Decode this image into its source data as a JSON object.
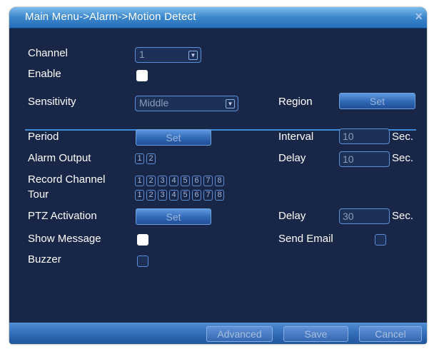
{
  "window": {
    "title": "Main Menu->Alarm->Motion Detect",
    "close_glyph": "×"
  },
  "fields": {
    "channel": {
      "label": "Channel",
      "value": "1"
    },
    "enable": {
      "label": "Enable",
      "checked": true
    },
    "sensitivity": {
      "label": "Sensitivity",
      "value": "Middle"
    },
    "region": {
      "label": "Region",
      "button": "Set"
    },
    "period": {
      "label": "Period",
      "button": "Set"
    },
    "interval": {
      "label": "Interval",
      "value": "10",
      "unit": "Sec."
    },
    "alarm_output": {
      "label": "Alarm Output",
      "options": [
        "1",
        "2"
      ]
    },
    "delay1": {
      "label": "Delay",
      "value": "10",
      "unit": "Sec."
    },
    "record_channel": {
      "label": "Record Channel",
      "options": [
        "1",
        "2",
        "3",
        "4",
        "5",
        "6",
        "7",
        "8"
      ]
    },
    "tour": {
      "label": "Tour",
      "options": [
        "1",
        "2",
        "3",
        "4",
        "5",
        "6",
        "7",
        "8"
      ]
    },
    "ptz": {
      "label": "PTZ Activation",
      "button": "Set"
    },
    "delay2": {
      "label": "Delay",
      "value": "30",
      "unit": "Sec."
    },
    "show_message": {
      "label": "Show Message",
      "checked": true
    },
    "send_email": {
      "label": "Send Email",
      "checked": false
    },
    "buzzer": {
      "label": "Buzzer",
      "checked": false
    }
  },
  "footer": {
    "advanced": "Advanced",
    "save": "Save",
    "cancel": "Cancel"
  },
  "colors": {
    "titlebar": "#3b86cb",
    "panel": "#182747",
    "border": "#5b8fd6"
  }
}
